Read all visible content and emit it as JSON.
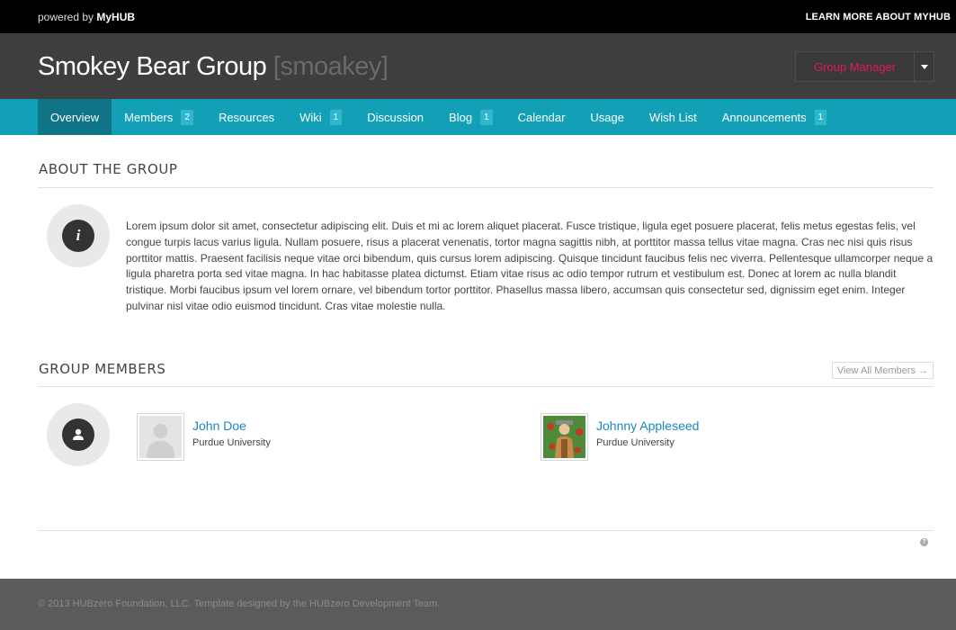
{
  "topbar": {
    "powered_prefix": "powered by",
    "brand": "MyHUB",
    "learn_more": "LEARN MORE ABOUT MYHUB"
  },
  "header": {
    "group_title": "Smokey Bear Group",
    "group_cn": "[smoakey]",
    "manager_label": "Group Manager"
  },
  "nav": {
    "tabs": [
      {
        "label": "Overview",
        "badge": null
      },
      {
        "label": "Members",
        "badge": "2"
      },
      {
        "label": "Resources",
        "badge": null
      },
      {
        "label": "Wiki",
        "badge": "1"
      },
      {
        "label": "Discussion",
        "badge": null
      },
      {
        "label": "Blog",
        "badge": "1"
      },
      {
        "label": "Calendar",
        "badge": null
      },
      {
        "label": "Usage",
        "badge": null
      },
      {
        "label": "Wish List",
        "badge": null
      },
      {
        "label": "Announcements",
        "badge": "1"
      }
    ]
  },
  "about": {
    "title": "ABOUT THE GROUP",
    "icon_glyph": "i",
    "body": "Lorem ipsum dolor sit amet, consectetur adipiscing elit. Duis et mi ac lorem aliquet placerat. Fusce tristique, ligula eget posuere placerat, felis metus egestas felis, vel congue turpis lacus varius ligula. Nullam posuere, risus a placerat venenatis, tortor magna sagittis nibh, at porttitor massa tellus vitae magna. Cras nec nisi quis risus porttitor mattis. Praesent facilisis neque vitae orci bibendum, quis cursus lorem adipiscing. Quisque tincidunt faucibus felis nec viverra. Pellentesque ullamcorper neque a ligula pharetra porta sed vitae magna. In hac habitasse platea dictumst. Etiam vitae risus ac odio tempor rutrum et vestibulum est. Donec at lorem ac nulla blandit tristique. Morbi faucibus ipsum vel lorem ornare, vel bibendum tortor porttitor. Phasellus massa libero, accumsan quis consectetur sed, dignissim eget enim. Integer pulvinar nisl vitae odio euismod tincidunt. Cras vitae molestie nulla."
  },
  "members": {
    "title": "GROUP MEMBERS",
    "view_all": "View All Members →",
    "list": [
      {
        "name": "John Doe",
        "org": "Purdue University"
      },
      {
        "name": "Johnny Appleseed",
        "org": "Purdue University"
      }
    ]
  },
  "help_glyph": "?",
  "footer": {
    "text": "© 2013 HUBzero Foundation, LLC. Template designed by the HUBzero Development Team."
  },
  "colors": {
    "nav": "#13a0b7",
    "nav_active": "#0e7486",
    "manager_accent": "#e0175b",
    "link": "#1a89b8"
  }
}
